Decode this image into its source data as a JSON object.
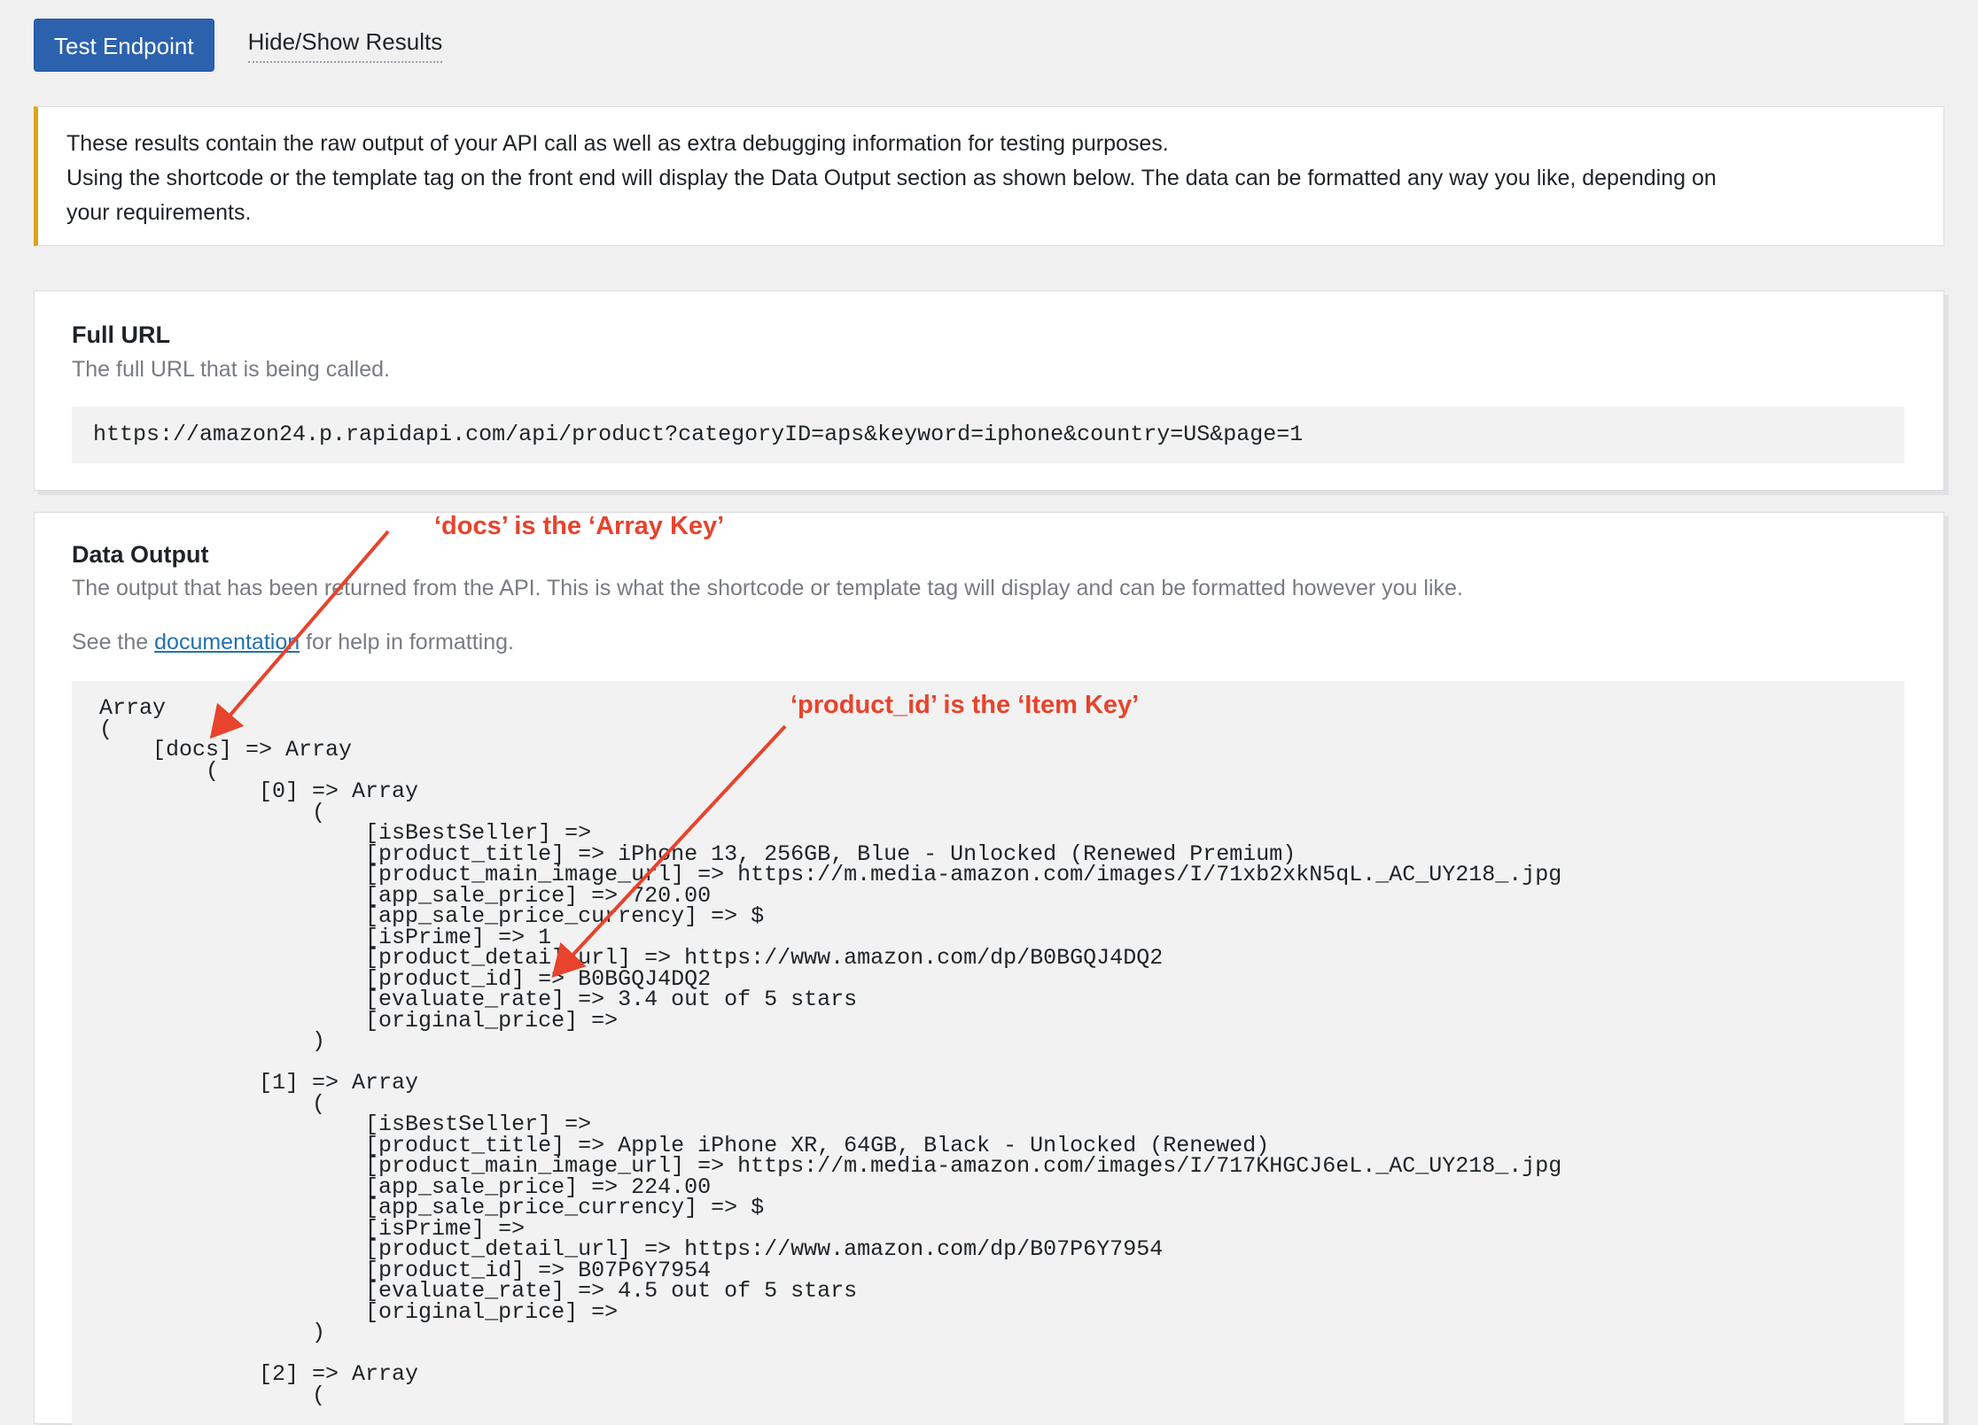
{
  "toolbar": {
    "test_button": "Test Endpoint",
    "toggle_link": "Hide/Show Results"
  },
  "notice": {
    "line1": "These results contain the raw output of your API call as well as extra debugging information for testing purposes.",
    "line2": "Using the shortcode or the template tag on the front end will display the Data Output section as shown below. The data can be formatted any way you like, depending on",
    "line3": "your requirements."
  },
  "full_url": {
    "title": "Full URL",
    "description": "The full URL that is being called.",
    "value": "https://amazon24.p.rapidapi.com/api/product?categoryID=aps&keyword=iphone&country=US&page=1"
  },
  "data_output": {
    "title": "Data Output",
    "description": "The output that has been returned from the API. This is what the shortcode or template tag will display and can be formatted however you like.",
    "see_prefix": "See the ",
    "doc_link": "documentation",
    "see_suffix": " for help in formatting.",
    "code": "Array\n(\n    [docs] => Array\n        (\n            [0] => Array\n                (\n                    [isBestSeller] => \n                    [product_title] => iPhone 13, 256GB, Blue - Unlocked (Renewed Premium)\n                    [product_main_image_url] => https://m.media-amazon.com/images/I/71xb2xkN5qL._AC_UY218_.jpg\n                    [app_sale_price] => 720.00\n                    [app_sale_price_currency] => $\n                    [isPrime] => 1\n                    [product_detail_url] => https://www.amazon.com/dp/B0BGQJ4DQ2\n                    [product_id] => B0BGQJ4DQ2\n                    [evaluate_rate] => 3.4 out of 5 stars\n                    [original_price] => \n                )\n\n            [1] => Array\n                (\n                    [isBestSeller] => \n                    [product_title] => Apple iPhone XR, 64GB, Black - Unlocked (Renewed)\n                    [product_main_image_url] => https://m.media-amazon.com/images/I/717KHGCJ6eL._AC_UY218_.jpg\n                    [app_sale_price] => 224.00\n                    [app_sale_price_currency] => $\n                    [isPrime] => \n                    [product_detail_url] => https://www.amazon.com/dp/B07P6Y7954\n                    [product_id] => B07P6Y7954\n                    [evaluate_rate] => 4.5 out of 5 stars\n                    [original_price] => \n                )\n\n            [2] => Array\n                ("
  },
  "annotations": {
    "array_key": "‘docs’ is the ‘Array Key’",
    "item_key": "‘product_id’ is the ‘Item Key’",
    "color": "#e8432c"
  },
  "colors": {
    "primary_button": "#2c62ad",
    "notice_accent": "#dba617",
    "link": "#2271b1",
    "page_bg": "#f0f0f1"
  }
}
